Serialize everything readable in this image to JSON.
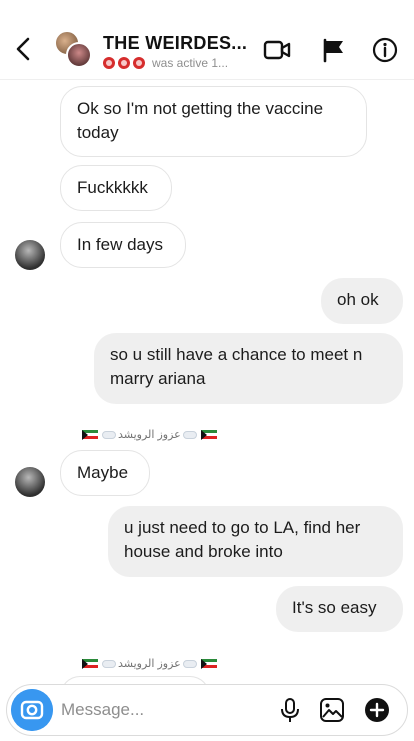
{
  "header": {
    "title": "THE WEIRDES...",
    "status": "was active 1..."
  },
  "messages": [
    {
      "text_lines": [
        "Ok so I'm not getting the vaccine",
        "today"
      ],
      "from": "them"
    },
    {
      "text_lines": [
        "Fuckkkkk"
      ],
      "from": "them"
    },
    {
      "text_lines": [
        "In few days"
      ],
      "from": "them"
    },
    {
      "text_lines": [
        "oh ok"
      ],
      "from": "me"
    },
    {
      "text_lines": [
        "so u still have a chance to meet n",
        "marry ariana"
      ],
      "from": "me"
    },
    {
      "text_lines": [
        "Maybe"
      ],
      "from": "them"
    },
    {
      "text_lines": [
        "u just need to go to LA, find her",
        "house and broke into"
      ],
      "from": "me"
    },
    {
      "text_lines": [
        "It's so easy"
      ],
      "from": "me"
    }
  ],
  "sender_label": "عزوز الرويشد",
  "composer": {
    "placeholder": "Message..."
  },
  "colors": {
    "accent": "#3897f0",
    "incoming_border": "#e4e4e4",
    "outgoing_bg": "#efefef"
  },
  "icons": {
    "back": "chevron-left-icon",
    "video": "video-call-icon",
    "flag": "flag-icon",
    "info": "info-icon",
    "camera": "camera-icon",
    "mic": "microphone-icon",
    "gallery": "gallery-icon",
    "add": "plus-circle-icon"
  }
}
